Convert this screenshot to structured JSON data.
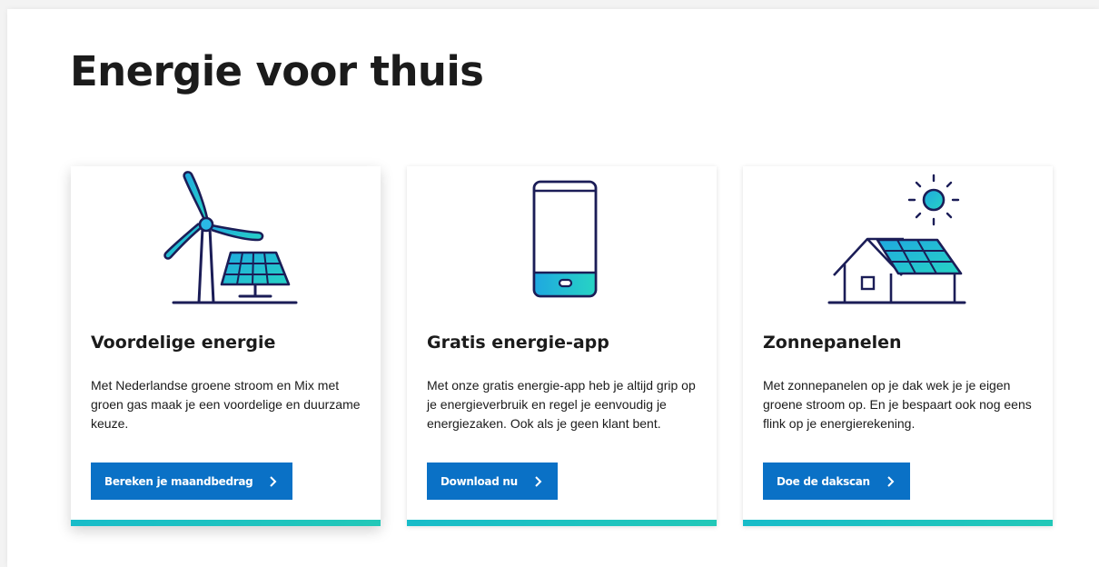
{
  "page": {
    "title": "Energie voor thuis"
  },
  "colors": {
    "navy": "#1b1d57",
    "button_blue": "#0a71c6",
    "accent_teal": "#1ec4c0",
    "icon_cyan": "#2ab8e6"
  },
  "cards": [
    {
      "illustration": "wind-turbine-solar-panel-icon",
      "title": "Voordelige energie",
      "text": "Met Nederlandse groene stroom en Mix met groen gas maak je een voordelige en duurzame keuze.",
      "button": "Bereken je maandbedrag",
      "button_icon": "chevron-right-icon"
    },
    {
      "illustration": "smartphone-icon",
      "title": "Gratis energie-app",
      "text": "Met onze gratis energie-app heb je altijd grip op je energieverbruik en regel je eenvoudig je energiezaken. Ook als je geen klant bent.",
      "button": "Download nu",
      "button_icon": "chevron-right-icon"
    },
    {
      "illustration": "house-solar-roof-sun-icon",
      "title": "Zonnepanelen",
      "text": "Met zonnepanelen op je dak wek je je eigen groene stroom op. En je bespaart ook nog eens flink op je energierekening.",
      "button": "Doe de dakscan",
      "button_icon": "chevron-right-icon"
    }
  ]
}
